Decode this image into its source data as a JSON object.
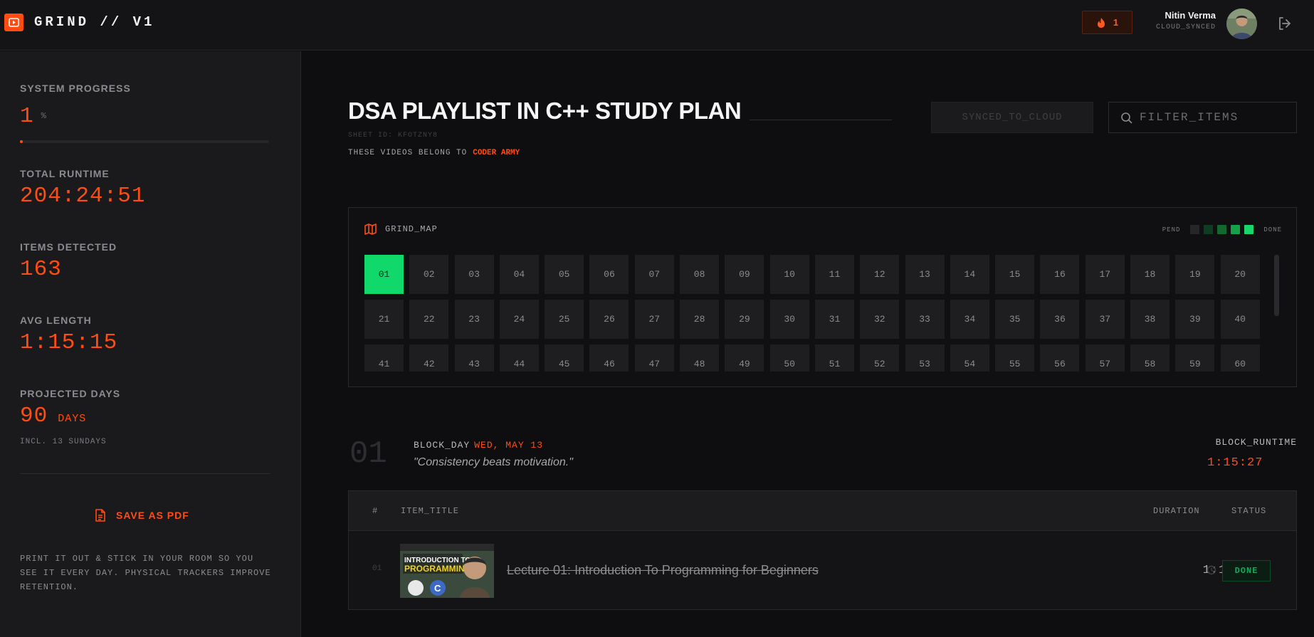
{
  "app": {
    "brand": "GRIND // V1"
  },
  "header": {
    "streak_count": "1",
    "user_name": "Nitin Verma",
    "user_status": "CLOUD_SYNCED"
  },
  "sidebar": {
    "progress_label": "SYSTEM PROGRESS",
    "progress_value": "1",
    "progress_unit": "%",
    "progress_fraction": 0.01,
    "runtime_label": "TOTAL RUNTIME",
    "runtime_value": "204:24:51",
    "items_label": "ITEMS DETECTED",
    "items_value": "163",
    "avg_label": "AVG LENGTH",
    "avg_value": "1:15:15",
    "days_label": "PROJECTED DAYS",
    "days_value": "90",
    "days_unit": "DAYS",
    "days_note": "INCL. 13 SUNDAYS",
    "pdf_label": "SAVE AS PDF",
    "print_note": "PRINT IT OUT & STICK IN YOUR ROOM SO YOU SEE IT EVERY DAY. PHYSICAL TRACKERS IMPROVE RETENTION."
  },
  "main": {
    "title": "DSA PLAYLIST IN C++ STUDY PLAN",
    "sheet_id": "SHEET ID: KFOTZNY8",
    "belongs_text": "THESE VIDEOS BELONG TO",
    "channel": "CODER ARMY",
    "sync_label": "SYNCED_TO_CLOUD",
    "filter_placeholder": "FILTER_ITEMS"
  },
  "grind_map": {
    "title": "GRIND_MAP",
    "legend_pend": "PEND",
    "legend_done": "DONE",
    "legend_colors": [
      "#26262a",
      "#0f3d22",
      "#11692f",
      "#13a24a",
      "#17d66a"
    ],
    "cells": [
      "01",
      "02",
      "03",
      "04",
      "05",
      "06",
      "07",
      "08",
      "09",
      "10",
      "11",
      "12",
      "13",
      "14",
      "15",
      "16",
      "17",
      "18",
      "19",
      "20",
      "21",
      "22",
      "23",
      "24",
      "25",
      "26",
      "27",
      "28",
      "29",
      "30",
      "31",
      "32",
      "33",
      "34",
      "35",
      "36",
      "37",
      "38",
      "39",
      "40",
      "41",
      "42",
      "43",
      "44",
      "45",
      "46",
      "47",
      "48",
      "49",
      "50",
      "51",
      "52",
      "53",
      "54",
      "55",
      "56",
      "57",
      "58",
      "59",
      "60"
    ],
    "done_cells": [
      "01"
    ]
  },
  "day_block": {
    "day_number": "01",
    "block_label": "BLOCK_DAY",
    "date": "WED, MAY 13",
    "quote": "\"Consistency beats motivation.\"",
    "runtime_label": "BLOCK_RUNTIME",
    "runtime_value": "1:15:27"
  },
  "table": {
    "headers": {
      "index": "#",
      "title": "ITEM_TITLE",
      "duration": "DURATION",
      "status": "STATUS"
    },
    "rows": [
      {
        "index": "01",
        "title": "Lecture 01: Introduction To Programming for Beginners",
        "duration": "1:15:27",
        "status": "DONE",
        "thumb_text": "INTRODUCTION TO PROGRAMMING"
      }
    ]
  },
  "colors": {
    "accent": "#ff4d12",
    "done_green": "#10d86b",
    "background": "#0e0e10",
    "sidebar": "#1a1a1d"
  },
  "icons": {
    "logo": "play-icon",
    "streak": "flame-icon",
    "logout": "logout-icon",
    "map": "map-icon",
    "pdf": "document-icon",
    "search": "search-icon",
    "duration": "clock-icon"
  }
}
